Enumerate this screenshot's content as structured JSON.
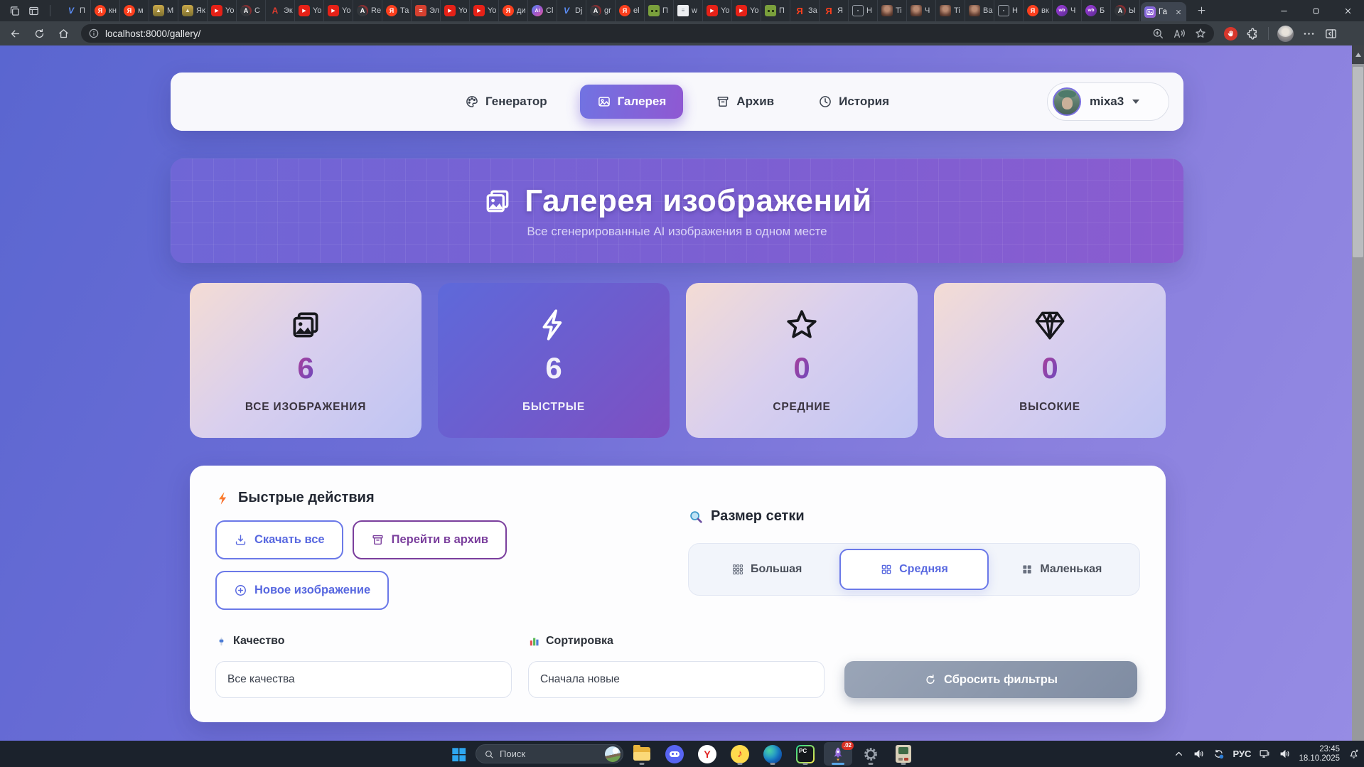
{
  "colors": {
    "page_gradient_start": "#5a66d0",
    "page_gradient_end": "#968ce4",
    "accent_blue": "#5868e0",
    "accent_purple": "#7b3f9d",
    "active_gradient_start": "#7173e2",
    "active_gradient_end": "#8f58d2",
    "adblock_red": "#d7372c",
    "badge_red": "#d93025"
  },
  "browser": {
    "url": "localhost:8000/gallery/",
    "tabs": [
      {
        "icon": "v-logo",
        "title": "П"
      },
      {
        "icon": "yandex",
        "title": "кн"
      },
      {
        "icon": "yandex",
        "title": "м"
      },
      {
        "icon": "image",
        "title": "М"
      },
      {
        "icon": "image",
        "title": "Як"
      },
      {
        "icon": "youtube",
        "title": "Yo"
      },
      {
        "icon": "dark-a",
        "title": "C"
      },
      {
        "icon": "red-a",
        "title": "Эк"
      },
      {
        "icon": "youtube",
        "title": "Yo"
      },
      {
        "icon": "youtube",
        "title": "Yo"
      },
      {
        "icon": "dark-a",
        "title": "Re"
      },
      {
        "icon": "yandex",
        "title": "Та"
      },
      {
        "icon": "red-book",
        "title": "Эл"
      },
      {
        "icon": "youtube",
        "title": "Yo"
      },
      {
        "icon": "youtube",
        "title": "Yo"
      },
      {
        "icon": "yandex",
        "title": "ди"
      },
      {
        "icon": "ai",
        "title": "Cl"
      },
      {
        "icon": "v-logo",
        "title": "Dj"
      },
      {
        "icon": "dark-a",
        "title": "gr"
      },
      {
        "icon": "yandex",
        "title": "el"
      },
      {
        "icon": "zombie",
        "title": "П"
      },
      {
        "icon": "doc",
        "title": "w"
      },
      {
        "icon": "youtube",
        "title": "Yo"
      },
      {
        "icon": "youtube",
        "title": "Yo"
      },
      {
        "icon": "zombie",
        "title": "П"
      },
      {
        "icon": "yandex-letter",
        "title": "За"
      },
      {
        "icon": "yandex-letter",
        "title": "Я"
      },
      {
        "icon": "card",
        "title": "Н"
      },
      {
        "icon": "avatar",
        "title": "Ti"
      },
      {
        "icon": "avatar",
        "title": "Ч"
      },
      {
        "icon": "avatar",
        "title": "Ti"
      },
      {
        "icon": "avatar",
        "title": "Ва"
      },
      {
        "icon": "card",
        "title": "Н"
      },
      {
        "icon": "yandex",
        "title": "вк"
      },
      {
        "icon": "wb",
        "title": "Ч"
      },
      {
        "icon": "wb",
        "title": "Б"
      },
      {
        "icon": "dark-a",
        "title": "Ы"
      }
    ],
    "active_tab": {
      "icon": "gallery-favicon",
      "title": "Га"
    },
    "toolbar_left_icons": [
      "back-icon",
      "refresh-icon",
      "home-icon"
    ],
    "addressbar_icons": [
      "zoom-in-icon",
      "read-aloud-icon",
      "favorite-star-icon"
    ],
    "toolbar_right_icons": [
      "adblock-icon",
      "extensions-icon",
      "profile-avatar",
      "more-options-icon",
      "sidebar-icon"
    ],
    "window_control_icons": [
      "minimize-icon",
      "maximize-icon",
      "close-icon"
    ]
  },
  "nav": {
    "items": [
      {
        "label": "Генератор",
        "icon": "palette-icon",
        "active": false
      },
      {
        "label": "Галерея",
        "icon": "gallery-icon",
        "active": true
      },
      {
        "label": "Архив",
        "icon": "archive-icon",
        "active": false
      },
      {
        "label": "История",
        "icon": "clock-icon",
        "active": false
      }
    ],
    "user": {
      "name": "mixa3"
    }
  },
  "hero": {
    "title": "Галерея изображений",
    "subtitle": "Все сгенерированные AI изображения в одном месте",
    "icon": "images-icon"
  },
  "stats": [
    {
      "icon": "images-icon",
      "value": "6",
      "label": "ВСЕ ИЗОБРАЖЕНИЯ",
      "active": false
    },
    {
      "icon": "bolt-icon",
      "value": "6",
      "label": "БЫСТРЫЕ",
      "active": true
    },
    {
      "icon": "star-icon",
      "value": "0",
      "label": "СРЕДНИЕ",
      "active": false
    },
    {
      "icon": "gem-icon",
      "value": "0",
      "label": "ВЫСОКИЕ",
      "active": false
    }
  ],
  "quick_actions": {
    "title": "Быстрые действия",
    "title_icon": "bolt-color-icon",
    "buttons": [
      {
        "label": "Скачать все",
        "icon": "download-icon",
        "style": "blue"
      },
      {
        "label": "Перейти в архив",
        "icon": "archive-icon",
        "style": "purple"
      },
      {
        "label": "Новое изображение",
        "icon": "plus-circle-icon",
        "style": "blue"
      }
    ]
  },
  "grid_size": {
    "title": "Размер сетки",
    "title_icon": "magnifier-color-icon",
    "options": [
      {
        "label": "Большая",
        "icon": "grid-large-icon",
        "active": false
      },
      {
        "label": "Средняя",
        "icon": "grid-medium-icon",
        "active": true
      },
      {
        "label": "Маленькая",
        "icon": "grid-small-icon",
        "active": false
      }
    ]
  },
  "filters": {
    "quality_label": "Качество",
    "quality_icon": "quality-icon",
    "quality_value": "Все качества",
    "sort_label": "Сортировка",
    "sort_icon": "sort-icon",
    "sort_value": "Сначала новые",
    "reset_label": "Сбросить фильтры",
    "reset_icon": "reset-icon"
  },
  "taskbar": {
    "search_placeholder": "Поиск",
    "apps": [
      {
        "name": "file-explorer",
        "running": true
      },
      {
        "name": "discord",
        "running": false
      },
      {
        "name": "yandex-browser",
        "running": false
      },
      {
        "name": "yandex-music",
        "running": true
      },
      {
        "name": "edge",
        "running": true
      },
      {
        "name": "pycharm",
        "running": true
      },
      {
        "name": "generator-app",
        "running": true,
        "active": true,
        "badge": ".02"
      },
      {
        "name": "settings",
        "running": true
      },
      {
        "name": "retro-console",
        "running": true
      }
    ],
    "tray": {
      "icons_left": [
        "chevron-up-icon",
        "volume-icon",
        "sync-icon"
      ],
      "language": "РУС",
      "icons_mid": [
        "display-icon",
        "volume-icon"
      ],
      "time": "23:45",
      "date": "18.10.2025",
      "icon_right": "bell-icon"
    }
  }
}
